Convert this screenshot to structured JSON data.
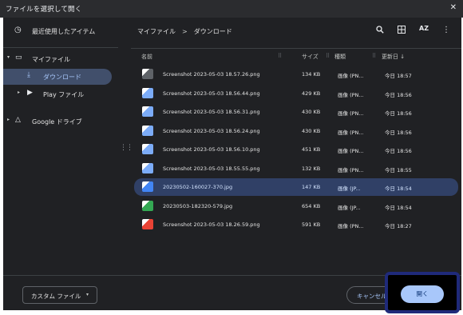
{
  "window": {
    "title": "ファイルを選択して開く",
    "close_icon": "close-icon"
  },
  "sidebar": {
    "recent": {
      "label": "最近使用したアイテム",
      "icon": "clock-icon"
    },
    "items": [
      {
        "label": "マイファイル",
        "icon": "laptop-icon",
        "expanded": true
      },
      {
        "label": "ダウンロード",
        "icon": "download-icon",
        "selected": true
      },
      {
        "label": "Play ファイル",
        "icon": "play-icon",
        "expanded": false
      },
      {
        "label": "Google ドライブ",
        "icon": "drive-icon",
        "expanded": false
      }
    ]
  },
  "breadcrumb": {
    "root": "マイファイル",
    "separator": ">",
    "current": "ダウンロード"
  },
  "toolbar": {
    "icons": [
      "search-icon",
      "grid-view-icon",
      "sort-az-icon",
      "more-vert-icon"
    ],
    "sort_label": "AZ"
  },
  "columns": {
    "name": "名前",
    "size": "サイズ",
    "type": "種類",
    "modified": "更新日",
    "sort_indicator": "↓"
  },
  "files": [
    {
      "name": "Screenshot 2023-05-03 18.57.26.png",
      "size": "134 KB",
      "type": "画像 (PN...",
      "date": "今日 18:57",
      "thumb": "#5f6368"
    },
    {
      "name": "Screenshot 2023-05-03 18.56.44.png",
      "size": "429 KB",
      "type": "画像 (PN...",
      "date": "今日 18:56",
      "thumb": "#7cacf8"
    },
    {
      "name": "Screenshot 2023-05-03 18.56.31.png",
      "size": "430 KB",
      "type": "画像 (PN...",
      "date": "今日 18:56",
      "thumb": "#7cacf8"
    },
    {
      "name": "Screenshot 2023-05-03 18.56.24.png",
      "size": "430 KB",
      "type": "画像 (PN...",
      "date": "今日 18:56",
      "thumb": "#7cacf8"
    },
    {
      "name": "Screenshot 2023-05-03 18.56.10.png",
      "size": "451 KB",
      "type": "画像 (PN...",
      "date": "今日 18:56",
      "thumb": "#7cacf8"
    },
    {
      "name": "Screenshot 2023-05-03 18.55.55.png",
      "size": "132 KB",
      "type": "画像 (PN...",
      "date": "今日 18:55",
      "thumb": "#7cacf8"
    },
    {
      "name": "20230502-160027-370.jpg",
      "size": "147 KB",
      "type": "画像 (JP...",
      "date": "今日 18:54",
      "thumb": "#4285f4",
      "selected": true
    },
    {
      "name": "20230503-182320-579.jpg",
      "size": "654 KB",
      "type": "画像 (JP...",
      "date": "今日 18:54",
      "thumb": "#34a853"
    },
    {
      "name": "Screenshot 2023-05-03 18.26.59.png",
      "size": "591 KB",
      "type": "画像 (PN...",
      "date": "今日 18:27",
      "thumb": "#ea4335"
    }
  ],
  "footer": {
    "filter_label": "カスタム ファイル",
    "cancel_label": "キャンセル",
    "open_label": "開く"
  },
  "colors": {
    "accent": "#a8c7fa",
    "selected_row": "#304066",
    "background": "#202124",
    "highlight_border": "#1f2a7a"
  }
}
